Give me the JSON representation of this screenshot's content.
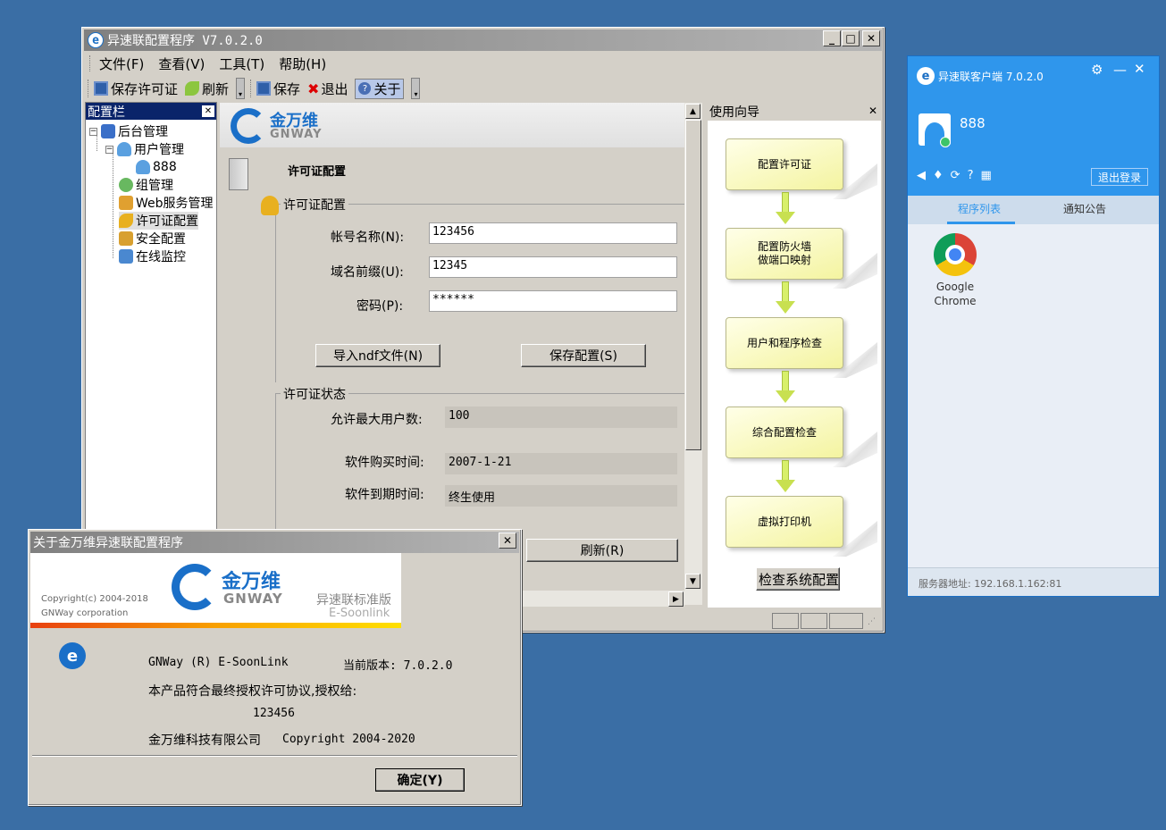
{
  "main": {
    "title": "异速联配置程序 V7.0.2.0",
    "menu": [
      "文件(F)",
      "查看(V)",
      "工具(T)",
      "帮助(H)"
    ],
    "toolbar": {
      "save_license": "保存许可证",
      "refresh": "刷新",
      "save": "保存",
      "exit": "退出",
      "about": "关于"
    },
    "config_bar": {
      "title": "配置栏",
      "items": [
        "后台管理",
        "用户管理",
        "888",
        "组管理",
        "Web服务管理",
        "许可证配置",
        "安全配置",
        "在线监控"
      ]
    },
    "brand": {
      "cn": "金万维",
      "en": "GNWAY"
    },
    "page_heading": "许可证配置",
    "license_group": {
      "legend": "许可证配置",
      "account_label": "帐号名称(N):",
      "account_value": "123456",
      "domain_label": "域名前缀(U):",
      "domain_value": "12345",
      "password_label": "密码(P):",
      "password_value": "******",
      "import_button": "导入ndf文件(N)",
      "save_button": "保存配置(S)"
    },
    "status_group": {
      "legend": "许可证状态",
      "max_users_label": "允许最大用户数:",
      "max_users_value": "100",
      "purchase_label": "软件购买时间:",
      "purchase_value": "2007-1-21",
      "expire_label": "软件到期时间:",
      "expire_value": "终生使用",
      "refresh_button": "刷新(R)"
    },
    "guide": {
      "title": "使用向导",
      "steps": [
        "配置许可证",
        "配置防火墙\n做端口映射",
        "用户和程序检查",
        "综合配置检查",
        "虚拟打印机"
      ],
      "check_button": "检查系统配置"
    }
  },
  "about": {
    "title": "关于金万维异速联配置程序",
    "copyright_small": "Copyright(c) 2004-2018",
    "corp_small": "GNWay corporation",
    "brand_cn": "金万维",
    "brand_en": "GNWAY",
    "edition": "异速联标准版",
    "edition_en": "E-Soonlink",
    "product": "GNWay (R) E-SoonLink",
    "version": "当前版本: 7.0.2.0",
    "license_line": "本产品符合最终授权许可协议,授权给:",
    "licensee": "123456",
    "company": "金万维科技有限公司",
    "copyright": "Copyright 2004-2020",
    "ok_button": "确定(Y)"
  },
  "client": {
    "title": "异速联客户端 7.0.2.0",
    "user": "888",
    "logout": "退出登录",
    "tabs": [
      "程序列表",
      "通知公告"
    ],
    "apps": [
      {
        "name": "Google\nChrome"
      }
    ],
    "server": "服务器地址: 192.168.1.162:81",
    "accent": "#2f96ec"
  }
}
